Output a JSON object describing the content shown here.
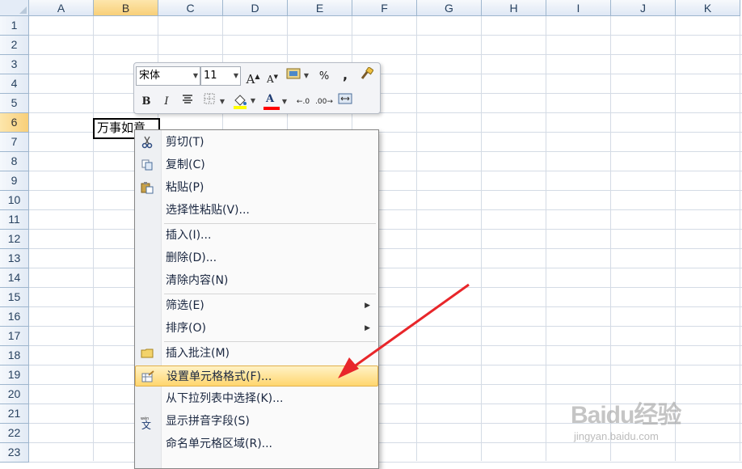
{
  "columns": [
    "A",
    "B",
    "C",
    "D",
    "E",
    "F",
    "G",
    "H",
    "I",
    "J",
    "K"
  ],
  "selected_column": "B",
  "rows": [
    "1",
    "2",
    "3",
    "4",
    "5",
    "6",
    "7",
    "8",
    "9",
    "10",
    "11",
    "12",
    "13",
    "14",
    "15",
    "16",
    "17",
    "18",
    "19",
    "20",
    "21",
    "22",
    "23"
  ],
  "selected_row": "6",
  "active_cell": {
    "ref": "B6",
    "value": "万事如意"
  },
  "mini_toolbar": {
    "font_name": "宋体",
    "font_size": "11",
    "grow_font": "A",
    "shrink_font": "A",
    "percent": "%",
    "comma": ",",
    "bold": "B",
    "italic": "I",
    "font_color_letter": "A",
    "fill_color": "#ffff00",
    "font_color": "#ff0000",
    "icons": [
      "increase-font-icon",
      "decrease-font-icon",
      "number-format-icon",
      "percent-icon",
      "comma-style-icon",
      "format-painter-icon",
      "bold-icon",
      "italic-icon",
      "center-align-icon",
      "borders-icon",
      "fill-color-icon",
      "font-color-icon",
      "increase-decimal-icon",
      "decrease-decimal-icon",
      "merge-center-icon"
    ]
  },
  "context_menu": {
    "items": [
      {
        "label": "剪切(T)",
        "icon": "scissors-icon"
      },
      {
        "label": "复制(C)",
        "icon": "copy-icon"
      },
      {
        "label": "粘贴(P)",
        "icon": "paste-icon"
      },
      {
        "label": "选择性粘贴(V)..."
      },
      {
        "label": "插入(I)..."
      },
      {
        "label": "删除(D)..."
      },
      {
        "label": "清除内容(N)"
      },
      {
        "label": "筛选(E)",
        "submenu": true
      },
      {
        "label": "排序(O)",
        "submenu": true
      },
      {
        "label": "插入批注(M)",
        "icon": "comment-icon"
      },
      {
        "label": "设置单元格格式(F)...",
        "icon": "format-cells-icon",
        "highlighted": true
      },
      {
        "label": "从下拉列表中选择(K)..."
      },
      {
        "label": "显示拼音字段(S)",
        "icon": "phonetic-icon"
      },
      {
        "label": "命名单元格区域(R)..."
      }
    ],
    "highlight_color": "#ffd66e"
  },
  "annotation": {
    "arrow_color": "#e8262a"
  },
  "watermark": {
    "logo_text": "Baidu经验",
    "url": "jingyan.baidu.com"
  }
}
